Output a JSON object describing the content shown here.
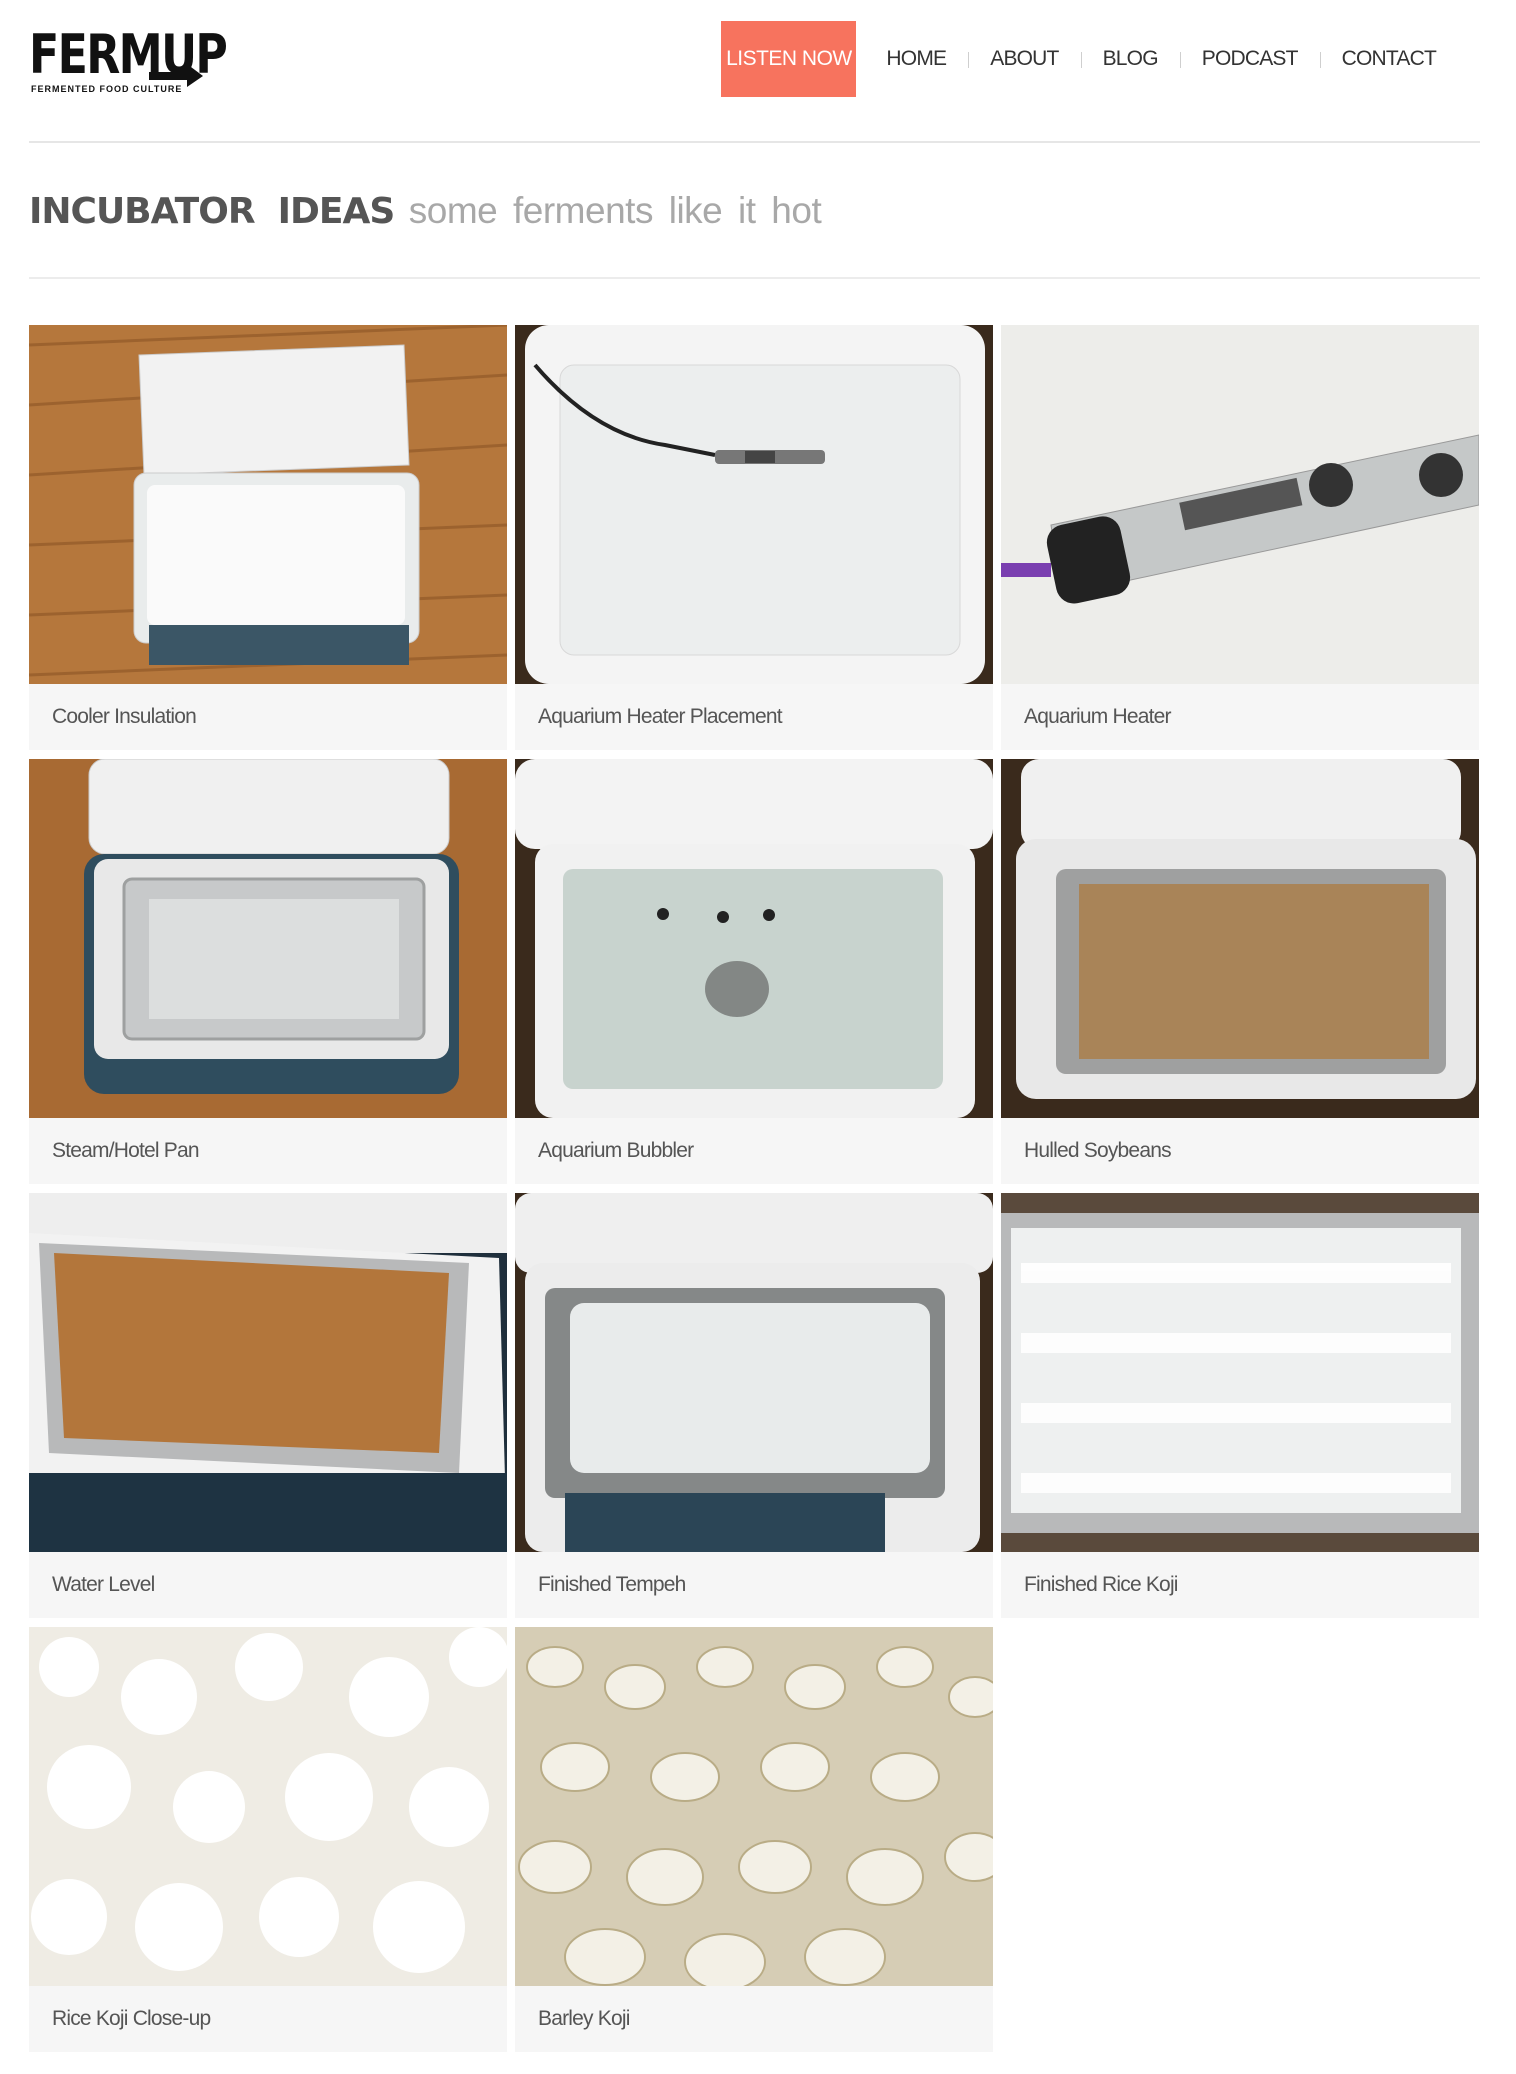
{
  "site": {
    "logo_text": "FERMUP",
    "logo_tagline": "FERMENTED FOOD CULTURE"
  },
  "nav": {
    "cta": "LISTEN NOW",
    "items": [
      "HOME",
      "ABOUT",
      "BLOG",
      "PODCAST",
      "CONTACT"
    ]
  },
  "page": {
    "title_bold": "INCUBATOR  IDEAS",
    "title_sub": "some ferments like it hot"
  },
  "colors": {
    "accent": "#f7735e"
  },
  "gallery": [
    {
      "caption": "Cooler Insulation"
    },
    {
      "caption": "Aquarium Heater Placement"
    },
    {
      "caption": "Aquarium Heater"
    },
    {
      "caption": "Steam/Hotel Pan"
    },
    {
      "caption": "Aquarium Bubbler"
    },
    {
      "caption": "Hulled Soybeans"
    },
    {
      "caption": "Water Level"
    },
    {
      "caption": "Finished Tempeh"
    },
    {
      "caption": "Finished Rice Koji"
    },
    {
      "caption": "Rice Koji Close-up"
    },
    {
      "caption": "Barley Koji"
    }
  ]
}
